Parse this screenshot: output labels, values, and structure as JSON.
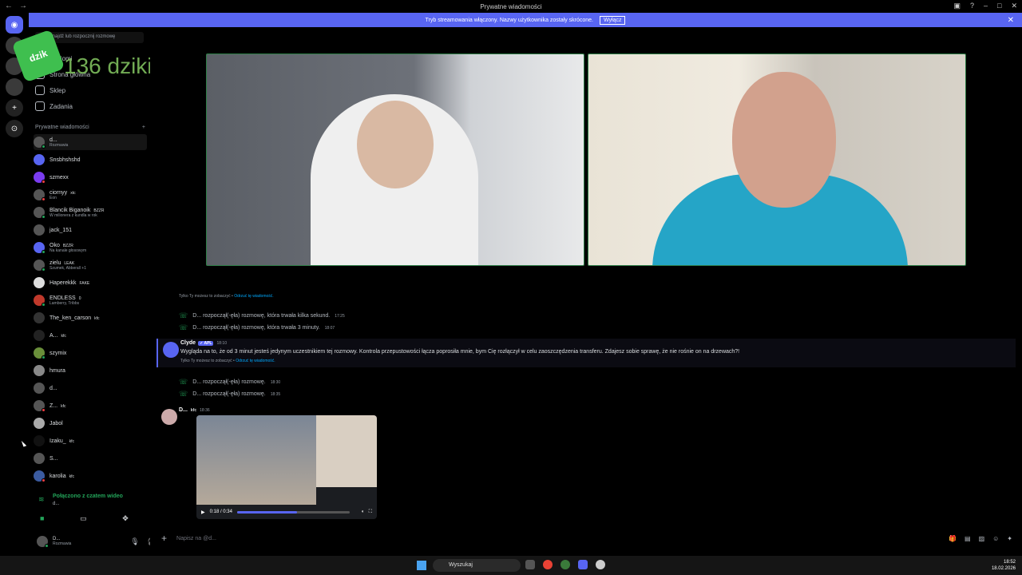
{
  "window": {
    "title": "Prywatne wiadomości"
  },
  "banner": {
    "text": "Tryb streamowania włączony. Nazwy użytkownika zostały skrócone.",
    "button": "Wyłącz"
  },
  "search": {
    "placeholder": "Znajdź lub rozpocznij rozmowę"
  },
  "nav": [
    {
      "label": "Znajomi"
    },
    {
      "label": "Strona główna"
    },
    {
      "label": "Sklep"
    },
    {
      "label": "Zadania"
    }
  ],
  "dm_header": "Prywatne wiadomości",
  "dms": [
    {
      "name": "d...",
      "sub": "Rozmawia",
      "tag": ""
    },
    {
      "name": "Snsbhshshd",
      "sub": "",
      "tag": ""
    },
    {
      "name": "szmexx",
      "sub": "",
      "tag": ""
    },
    {
      "name": "ciornyy",
      "sub": "Eon",
      "tag": "xtc"
    },
    {
      "name": "Blancik Biganoik",
      "sub": "W milionera z kundla w rok",
      "tag": "BZZR"
    },
    {
      "name": "jack_151",
      "sub": "",
      "tag": ""
    },
    {
      "name": "Oko",
      "sub": "Na kanale głosowym",
      "tag": "BZZR"
    },
    {
      "name": "zielu",
      "sub": "Szumek, Abberall +1",
      "tag": "LEAK"
    },
    {
      "name": "Haperekkk",
      "sub": "",
      "tag": "FAKE"
    },
    {
      "name": "ENDLESS",
      "sub": "Lamberry, Tribbs",
      "tag": "0"
    },
    {
      "name": "The_ken_carson",
      "sub": "",
      "tag": "kfc"
    },
    {
      "name": "A...",
      "sub": "",
      "tag": "kfc"
    },
    {
      "name": "szymix",
      "sub": "",
      "tag": ""
    },
    {
      "name": "hmura",
      "sub": "",
      "tag": ""
    },
    {
      "name": "d...",
      "sub": "",
      "tag": ""
    },
    {
      "name": "Z...",
      "sub": "",
      "tag": "kfc"
    },
    {
      "name": "Jabol",
      "sub": "",
      "tag": ""
    },
    {
      "name": "Izaku_",
      "sub": "",
      "tag": "kfc"
    },
    {
      "name": "S...",
      "sub": "",
      "tag": ""
    },
    {
      "name": "karolia",
      "sub": "",
      "tag": "kfc"
    }
  ],
  "voice": {
    "status": "Połączono z czatem wideo",
    "channel": "d..."
  },
  "user": {
    "name": "D...",
    "status": "Rozmawia"
  },
  "overlay": {
    "text": "136 dziki wypite",
    "sticker": "dzik"
  },
  "chat": {
    "ephemeral1": {
      "text": "Tylko Ty możesz to zobaczyć •",
      "link": "Odrzuć tę wiadomość."
    },
    "call1": {
      "text": "D... rozpoczął(-ęła) rozmowę, która trwała kilka sekund.",
      "time": "17:25"
    },
    "call2": {
      "text": "D... rozpoczął(-ęła) rozmowę, która trwała 3 minuty.",
      "time": "18:07"
    },
    "clyde": {
      "author": "Clyde",
      "badge": "✓ APL",
      "time": "18:10",
      "text": "Wygląda na to, że od 3 minut jesteś jedynym uczestnikiem tej rozmowy. Kontrola przepustowości łącza poprosiła mnie, bym Cię rozłączył w celu zaoszczędzenia transferu. Zdajesz sobie sprawę, że nie rośnie on na drzewach?!"
    },
    "ephemeral2": {
      "text": "Tylko Ty możesz to zobaczyć •",
      "link": "Odrzuć tę wiadomość."
    },
    "call3": {
      "text": "D... rozpoczął(-ęła) rozmowę.",
      "time": "18:30"
    },
    "call4": {
      "text": "D... rozpoczął(-ęła) rozmowę.",
      "time": "18:35"
    },
    "videomsg": {
      "author": "D...",
      "tag": "kfc",
      "time": "18:36",
      "timecode": "0:18 / 0:34",
      "progress": 0.53
    },
    "composer_placeholder": "Napisz na @d..."
  },
  "taskbar": {
    "search": "Wyszukaj",
    "time": "18:52",
    "date": "18.02.2026"
  }
}
